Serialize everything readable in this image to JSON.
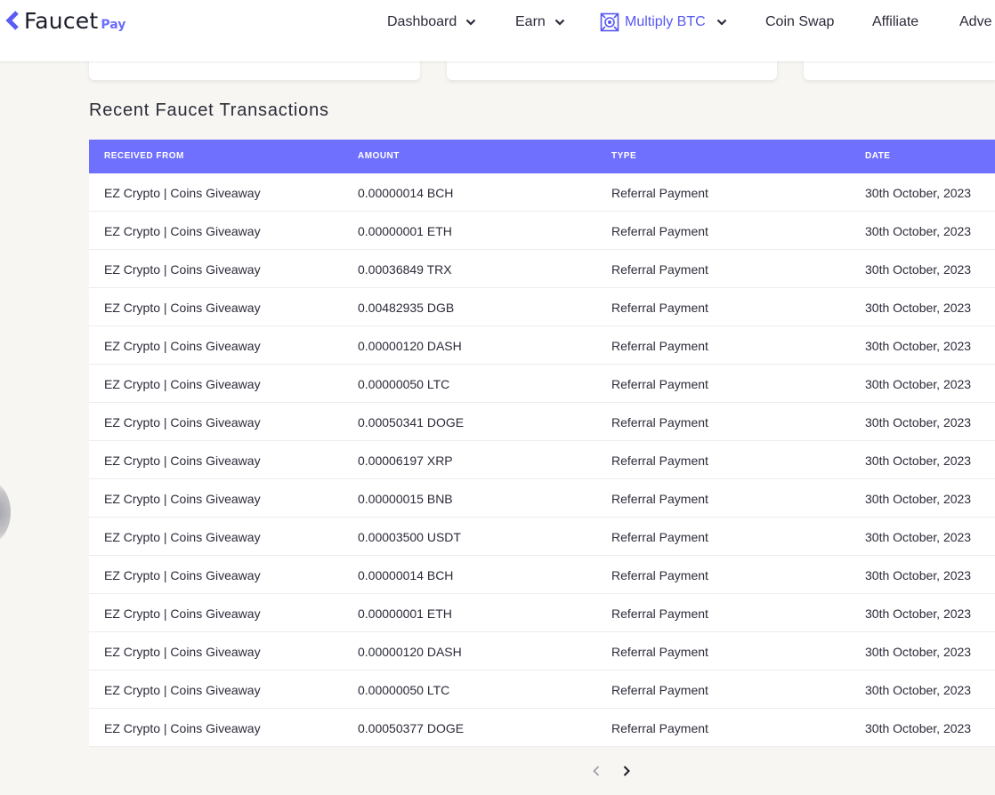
{
  "brand": {
    "name": "Faucet",
    "suffix": "Pay"
  },
  "nav": [
    {
      "label": "Dashboard",
      "dropdown": true,
      "active": false
    },
    {
      "label": "Earn",
      "dropdown": true,
      "active": false
    },
    {
      "label": "Multiply BTC",
      "dropdown": true,
      "active": true
    },
    {
      "label": "Coin Swap",
      "dropdown": false,
      "active": false
    },
    {
      "label": "Affiliate",
      "dropdown": false,
      "active": false
    },
    {
      "label": "Adve",
      "dropdown": false,
      "active": false
    }
  ],
  "section": {
    "title": "Recent Faucet Transactions"
  },
  "table": {
    "columns": [
      "RECEIVED FROM",
      "AMOUNT",
      "TYPE",
      "DATE"
    ],
    "rows": [
      [
        "EZ Crypto | Coins Giveaway",
        "0.00000014 BCH",
        "Referral Payment",
        "30th October, 2023"
      ],
      [
        "EZ Crypto | Coins Giveaway",
        "0.00000001 ETH",
        "Referral Payment",
        "30th October, 2023"
      ],
      [
        "EZ Crypto | Coins Giveaway",
        "0.00036849 TRX",
        "Referral Payment",
        "30th October, 2023"
      ],
      [
        "EZ Crypto | Coins Giveaway",
        "0.00482935 DGB",
        "Referral Payment",
        "30th October, 2023"
      ],
      [
        "EZ Crypto | Coins Giveaway",
        "0.00000120 DASH",
        "Referral Payment",
        "30th October, 2023"
      ],
      [
        "EZ Crypto | Coins Giveaway",
        "0.00000050 LTC",
        "Referral Payment",
        "30th October, 2023"
      ],
      [
        "EZ Crypto | Coins Giveaway",
        "0.00050341 DOGE",
        "Referral Payment",
        "30th October, 2023"
      ],
      [
        "EZ Crypto | Coins Giveaway",
        "0.00006197 XRP",
        "Referral Payment",
        "30th October, 2023"
      ],
      [
        "EZ Crypto | Coins Giveaway",
        "0.00000015 BNB",
        "Referral Payment",
        "30th October, 2023"
      ],
      [
        "EZ Crypto | Coins Giveaway",
        "0.00003500 USDT",
        "Referral Payment",
        "30th October, 2023"
      ],
      [
        "EZ Crypto | Coins Giveaway",
        "0.00000014 BCH",
        "Referral Payment",
        "30th October, 2023"
      ],
      [
        "EZ Crypto | Coins Giveaway",
        "0.00000001 ETH",
        "Referral Payment",
        "30th October, 2023"
      ],
      [
        "EZ Crypto | Coins Giveaway",
        "0.00000120 DASH",
        "Referral Payment",
        "30th October, 2023"
      ],
      [
        "EZ Crypto | Coins Giveaway",
        "0.00000050 LTC",
        "Referral Payment",
        "30th October, 2023"
      ],
      [
        "EZ Crypto | Coins Giveaway",
        "0.00050377 DOGE",
        "Referral Payment",
        "30th October, 2023"
      ]
    ]
  },
  "pagination": {
    "prev_icon": "chevron-left-icon",
    "next_icon": "chevron-right-icon",
    "prev_enabled": false,
    "next_enabled": true
  },
  "colors": {
    "accent": "#7070ff",
    "nav_active": "#5757f2",
    "background": "#f7f6f2"
  }
}
